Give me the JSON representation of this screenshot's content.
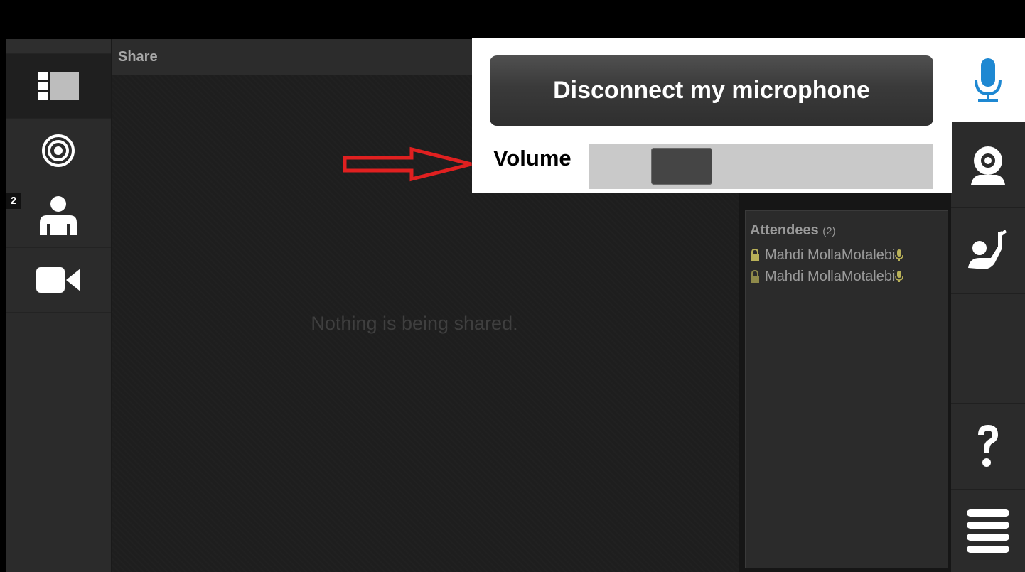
{
  "left_nav": {
    "participants_badge": "2"
  },
  "share": {
    "header": "Share",
    "empty_message": "Nothing is being shared."
  },
  "audio": {
    "disconnect_label": "Disconnect my microphone",
    "volume_label": "Volume",
    "volume_level": 0.18
  },
  "attendees": {
    "title": "Attendees",
    "count": "(2)",
    "items": [
      {
        "name": "Mahdi MollaMotalebi",
        "lock_color": "#b9b158"
      },
      {
        "name": "Mahdi MollaMotalebi",
        "lock_color": "#8f8a4a"
      }
    ]
  },
  "icons": {
    "layout": "layout-icon",
    "broadcast": "broadcast-icon",
    "participants": "user-icon",
    "camera": "video-camera-icon",
    "microphone": "microphone-icon",
    "webcam": "webcam-icon",
    "raise_hand": "raise-hand-icon",
    "help": "help-icon",
    "menu": "menu-icon"
  },
  "colors": {
    "accent": "#1e88d2",
    "annotation_arrow": "#e02020"
  }
}
